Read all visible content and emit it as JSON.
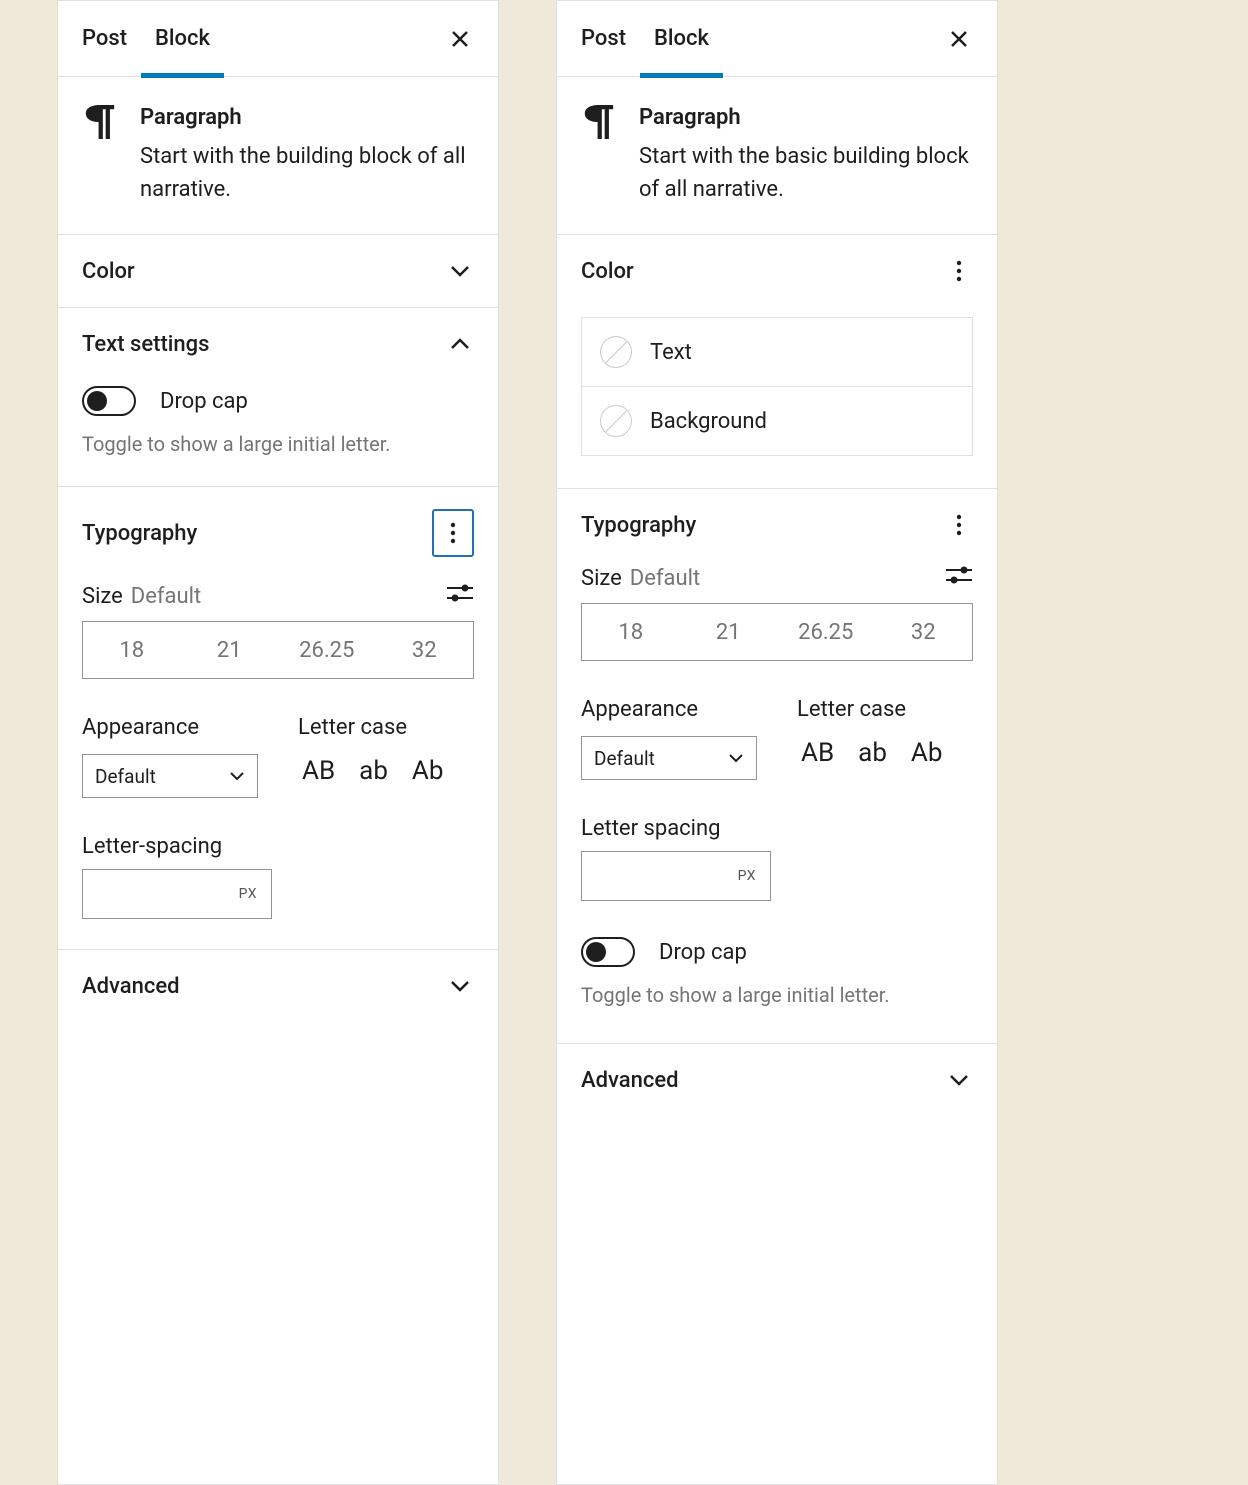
{
  "left": {
    "tabs": {
      "post": "Post",
      "block": "Block",
      "active": "block"
    },
    "block": {
      "title": "Paragraph",
      "description": "Start with the building block of all narrative."
    },
    "color_section": {
      "title": "Color"
    },
    "text_settings": {
      "title": "Text settings",
      "dropcap_label": "Drop cap",
      "dropcap_help": "Toggle to show a large initial letter."
    },
    "typography": {
      "title": "Typography",
      "size_label": "Size",
      "size_default": "Default",
      "sizes": [
        "18",
        "21",
        "26.25",
        "32"
      ],
      "appearance_label": "Appearance",
      "appearance_value": "Default",
      "lettercase_label": "Letter case",
      "cases": [
        "AB",
        "ab",
        "Ab"
      ],
      "spacing_label": "Letter-spacing",
      "spacing_unit": "PX"
    },
    "advanced": {
      "title": "Advanced"
    }
  },
  "right": {
    "tabs": {
      "post": "Post",
      "block": "Block",
      "active": "block"
    },
    "block": {
      "title": "Paragraph",
      "description": "Start with the basic building block of all narrative."
    },
    "color_section": {
      "title": "Color",
      "items": [
        {
          "label": "Text"
        },
        {
          "label": "Background"
        }
      ]
    },
    "typography": {
      "title": "Typography",
      "size_label": "Size",
      "size_default": "Default",
      "sizes": [
        "18",
        "21",
        "26.25",
        "32"
      ],
      "appearance_label": "Appearance",
      "appearance_value": "Default",
      "lettercase_label": "Letter case",
      "cases": [
        "AB",
        "ab",
        "Ab"
      ],
      "spacing_label": "Letter spacing",
      "spacing_unit": "PX",
      "dropcap_label": "Drop cap",
      "dropcap_help": "Toggle to show a large initial letter."
    },
    "advanced": {
      "title": "Advanced"
    }
  }
}
